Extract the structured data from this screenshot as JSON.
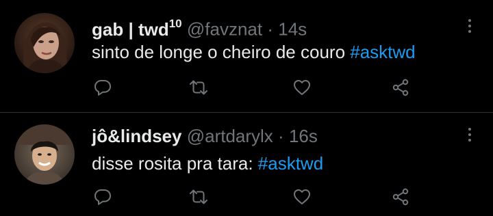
{
  "colors": {
    "background": "#000000",
    "text": "#e7e9ea",
    "muted": "#71767b",
    "link": "#1d9bf0",
    "divider": "#2f3336"
  },
  "tweets": [
    {
      "display_name": "gab | twd",
      "display_name_superscript": "10",
      "handle": "@favznat",
      "separator": "·",
      "time": "14s",
      "text": "sinto de longe o cheiro de couro ",
      "hashtag": "#asktwd",
      "icons": [
        "reply-icon",
        "retweet-icon",
        "like-icon",
        "share-icon"
      ]
    },
    {
      "display_name": "jô&lindsey",
      "handle": "@artdarylx",
      "separator": "·",
      "time": "16s",
      "text": "disse rosita pra tara: ",
      "hashtag": "#asktwd",
      "icons": [
        "reply-icon",
        "retweet-icon",
        "like-icon",
        "share-icon"
      ]
    }
  ]
}
